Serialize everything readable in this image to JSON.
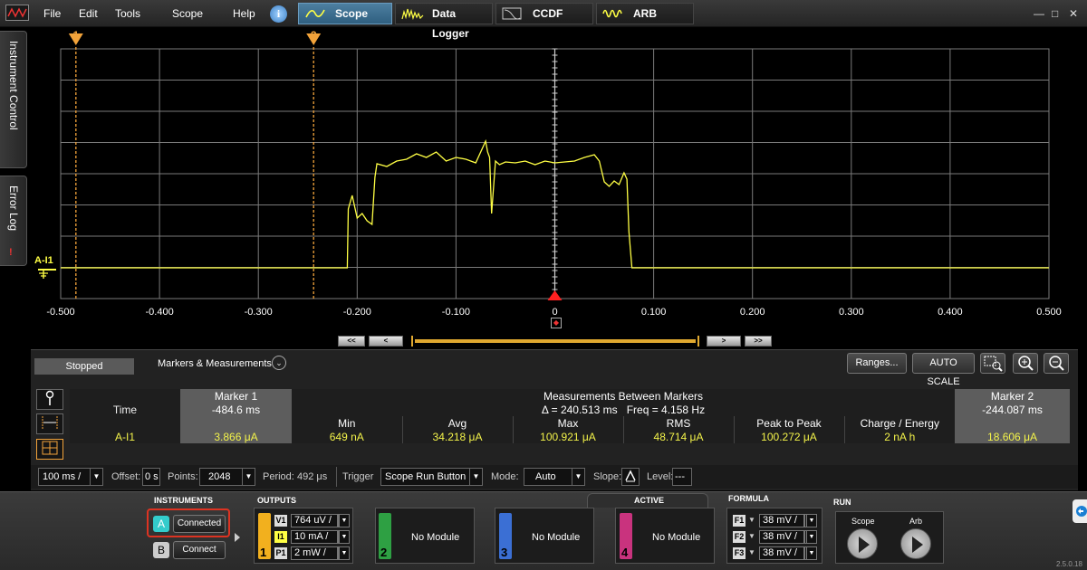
{
  "menu": [
    "File",
    "Edit",
    "Tools",
    "Scope",
    "Help"
  ],
  "tabs": [
    {
      "label": "Scope",
      "active": true
    },
    {
      "label": "Data Logger",
      "active": false
    },
    {
      "label": "CCDF",
      "active": false
    },
    {
      "label": "ARB",
      "active": false
    }
  ],
  "window_controls": {
    "minimize": "—",
    "maximize": "□",
    "close": "✕"
  },
  "side_tabs": {
    "instrument_control": "Instrument Control",
    "error_log": "Error Log",
    "error_indicator": "!"
  },
  "scope": {
    "trace_label": "A-I1",
    "marker1_flag": "1",
    "marker2_flag": "2",
    "x_ticks": [
      "-0.500",
      "-0.400",
      "-0.300",
      "-0.200",
      "-0.100",
      "0",
      "0.100",
      "0.200",
      "0.300",
      "0.400",
      "0.500"
    ],
    "x_range": [
      -0.5,
      0.5
    ],
    "marker1_x": -0.4846,
    "marker2_x": -0.244087,
    "scroll": {
      "far_left": "<<",
      "left": "<",
      "right": ">",
      "far_right": ">>"
    },
    "colors": {
      "trace": "#ffff44",
      "marker": "#f2a33a",
      "grid": "#7a7a7a",
      "trigger": "#ff2020"
    }
  },
  "chart_data": {
    "type": "line",
    "x": [
      -0.5,
      -0.21,
      -0.209,
      -0.205,
      -0.2,
      -0.195,
      -0.19,
      -0.185,
      -0.182,
      -0.18,
      -0.17,
      -0.16,
      -0.15,
      -0.14,
      -0.13,
      -0.12,
      -0.11,
      -0.1,
      -0.09,
      -0.08,
      -0.07,
      -0.068,
      -0.066,
      -0.064,
      -0.06,
      -0.057,
      -0.056,
      -0.05,
      -0.04,
      -0.03,
      -0.02,
      -0.01,
      0,
      0.01,
      0.02,
      0.03,
      0.04,
      0.045,
      0.05,
      0.055,
      0.06,
      0.065,
      0.07,
      0.073,
      0.075,
      0.078,
      0.5
    ],
    "y": [
      0,
      0,
      65,
      80,
      55,
      60,
      52,
      48,
      100,
      115,
      112,
      118,
      120,
      126,
      122,
      128,
      118,
      122,
      120,
      116,
      140,
      128,
      122,
      60,
      118,
      115,
      114,
      117,
      116,
      118,
      114,
      118,
      116,
      117,
      118,
      122,
      125,
      118,
      95,
      90,
      96,
      92,
      105,
      98,
      40,
      0,
      0
    ],
    "series": [
      {
        "name": "A-I1"
      }
    ],
    "xlabel": "",
    "ylabel": "",
    "xlim": [
      -0.5,
      0.5
    ],
    "ylim": [
      -10,
      260
    ],
    "grid": true
  },
  "panel": {
    "status": "Stopped",
    "markers_title": "Markers & Measurements",
    "chevron": "⌄",
    "ranges_btn": "Ranges...",
    "autoscale_btn": "AUTO SCALE"
  },
  "table": {
    "time_label": "Time",
    "channel_label": "A-I1",
    "marker1_header": "Marker 1",
    "marker2_header": "Marker 2",
    "marker1_time": "-484.6 ms",
    "marker2_time": "-244.087 ms",
    "between_header": "Measurements Between Markers",
    "delta": "Δ = 240.513 ms",
    "freq": "Freq = 4.158 Hz",
    "columns": [
      "Min",
      "Avg",
      "Max",
      "RMS",
      "Peak to Peak",
      "Charge / Energy"
    ],
    "values": [
      "649 nA",
      "34.218 μA",
      "100.921 μA",
      "48.714 μA",
      "100.272 μA",
      "2 nA h"
    ],
    "marker1_value": "3.866 μA",
    "marker2_value": "18.606 μA"
  },
  "settings": {
    "timebase": "100 ms /",
    "offset_label": "Offset:",
    "offset_value": "0 s",
    "points_label": "Points:",
    "points_value": "2048",
    "period_label": "Period:",
    "period_value": "492 μs",
    "trigger_label": "Trigger",
    "trigger_value": "Scope Run Button",
    "mode_label": "Mode:",
    "mode_value": "Auto",
    "slope_label": "Slope:",
    "level_label": "Level:",
    "level_value": "---"
  },
  "instruments": {
    "title": "INSTRUMENTS",
    "a_letter": "A",
    "a_state": "Connected",
    "b_letter": "B",
    "b_state": "Connect"
  },
  "outputs": {
    "title": "OUTPUTS",
    "channel_num": "1",
    "v_tag": "V1",
    "v_value": "764 uV /",
    "i_tag": "I1",
    "i_value": "10 mA /",
    "p_tag": "P1",
    "p_value": "2 mW /",
    "modules": [
      {
        "num": "2",
        "label": "No Module",
        "color": "#2ea043"
      },
      {
        "num": "3",
        "label": "No Module",
        "color": "#3b6fd4"
      },
      {
        "num": "4",
        "label": "No Module",
        "color": "#c9337e"
      }
    ],
    "ch1_color": "#f2b01e"
  },
  "active_title": "ACTIVE",
  "formula": {
    "title": "FORMULA",
    "items": [
      {
        "tag": "F1",
        "value": "38 mV /"
      },
      {
        "tag": "F2",
        "value": "38 mV /"
      },
      {
        "tag": "F3",
        "value": "38 mV /"
      }
    ]
  },
  "run": {
    "title": "RUN",
    "scope": "Scope",
    "arb": "Arb"
  },
  "version": "2.5.0.18"
}
